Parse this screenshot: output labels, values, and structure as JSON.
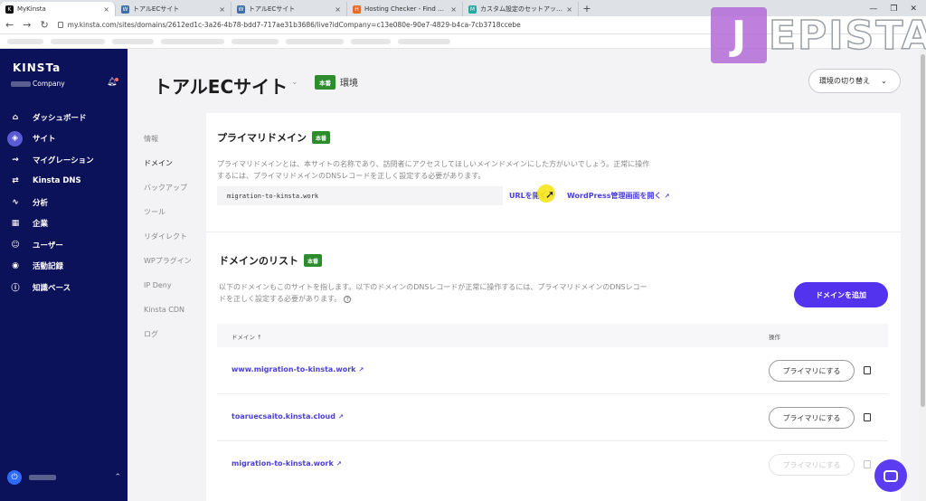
{
  "browser": {
    "tabs": [
      {
        "label": "MyKinsta",
        "icon": "kinsta-icon",
        "active": true
      },
      {
        "label": "トアルECサイト",
        "icon": "wordpress-icon",
        "active": false
      },
      {
        "label": "トアルECサイト",
        "icon": "wordpress-icon",
        "active": false
      },
      {
        "label": "Hosting Checker - Find out who...",
        "icon": "hosting-checker-icon",
        "active": false
      },
      {
        "label": "カスタム設定のセットアップ方法 – ム...",
        "icon": "m-icon",
        "active": false
      }
    ],
    "new_tab": "+",
    "url": "my.kinsta.com/sites/domains/2612ed1c-3a26-4b78-bdd7-717ae31b3686/live?idCompany=c13e080e-90e7-4829-b4ca-7cb3718ccebe"
  },
  "watermark": {
    "first": "J",
    "rest": "EPISTA"
  },
  "sidebar": {
    "logo": "KINSTa",
    "company": "Company",
    "items": [
      {
        "label": "ダッシュボード",
        "icon": "home-icon"
      },
      {
        "label": "サイト",
        "icon": "sites-icon",
        "active": true
      },
      {
        "label": "マイグレーション",
        "icon": "migration-icon"
      },
      {
        "label": "Kinsta DNS",
        "icon": "dns-icon"
      },
      {
        "label": "分析",
        "icon": "analytics-icon"
      },
      {
        "label": "企業",
        "icon": "company-icon"
      },
      {
        "label": "ユーザー",
        "icon": "user-add-icon"
      },
      {
        "label": "活動記録",
        "icon": "eye-icon"
      },
      {
        "label": "知識ベース",
        "icon": "help-icon"
      }
    ]
  },
  "header": {
    "title": "トアルECサイト",
    "env_badge": "本番",
    "env_label": "環境",
    "env_switch": "環境の切り替え"
  },
  "subnav": [
    {
      "label": "情報"
    },
    {
      "label": "ドメイン",
      "active": true
    },
    {
      "label": "バックアップ"
    },
    {
      "label": "ツール"
    },
    {
      "label": "リダイレクト"
    },
    {
      "label": "WPプラグイン"
    },
    {
      "label": "IP Deny"
    },
    {
      "label": "Kinsta CDN"
    },
    {
      "label": "ログ"
    }
  ],
  "primary": {
    "title": "プライマリドメイン",
    "badge": "本番",
    "desc1": "プライマリドメインとは、本サイトの名称であり、訪問者にアクセスしてほしいメインドメインにした方がいいでしょう。正常に操作",
    "desc2": "するには、プライマリドメインのDNSレコードを正しく設定する必要があります。",
    "domain": "migration-to-kinsta.work",
    "open_url": "URLを開く",
    "open_wp": "WordPress管理画面を開く"
  },
  "domain_list": {
    "title": "ドメインのリスト",
    "badge": "本番",
    "desc1": "以下のドメインもこのサイトを指します。以下のドメインのDNSレコードが正常に操作するには、プライマリドメインのDNSレコー",
    "desc2": "ドを正しく設定する必要があります。",
    "help": "?",
    "add_button": "ドメインを追加",
    "col_domain": "ドメイン ↑",
    "col_action": "操作",
    "rows": [
      {
        "domain": "www.migration-to-kinsta.work",
        "action": "プライマリにする",
        "disabled": false
      },
      {
        "domain": "toaruecsaito.kinsta.cloud",
        "action": "プライマリにする",
        "disabled": false
      },
      {
        "domain": "migration-to-kinsta.work",
        "action": "プライマリにする",
        "disabled": true
      }
    ]
  }
}
